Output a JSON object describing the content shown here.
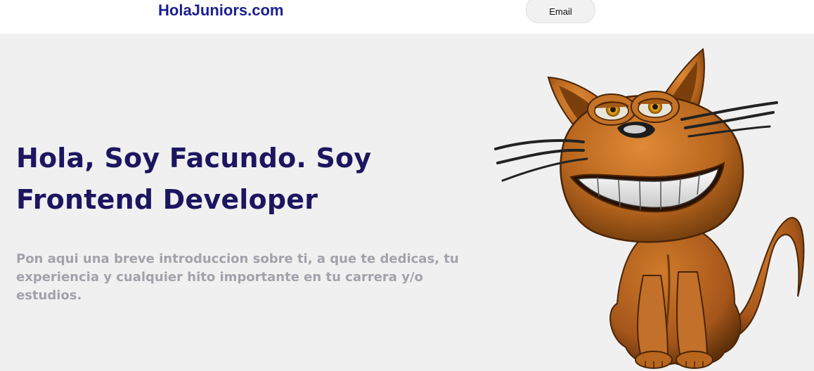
{
  "header": {
    "brand": "HolaJuniors.com",
    "email_label": "Email"
  },
  "hero": {
    "title": "Hola, Soy Facundo. Soy Frontend Developer",
    "intro": "Pon aqui una breve introduccion sobre ti, a que te dedicas, tu experiencia y cualquier hito importante en tu carrera y/o estudios."
  },
  "colors": {
    "brand": "#1b1f8f",
    "title": "#1c1660",
    "intro": "#a3a2ab",
    "background": "#f0f0f0",
    "cat_fur": "#b8661e"
  },
  "illustration": {
    "icon": "grinning-cat-icon"
  }
}
